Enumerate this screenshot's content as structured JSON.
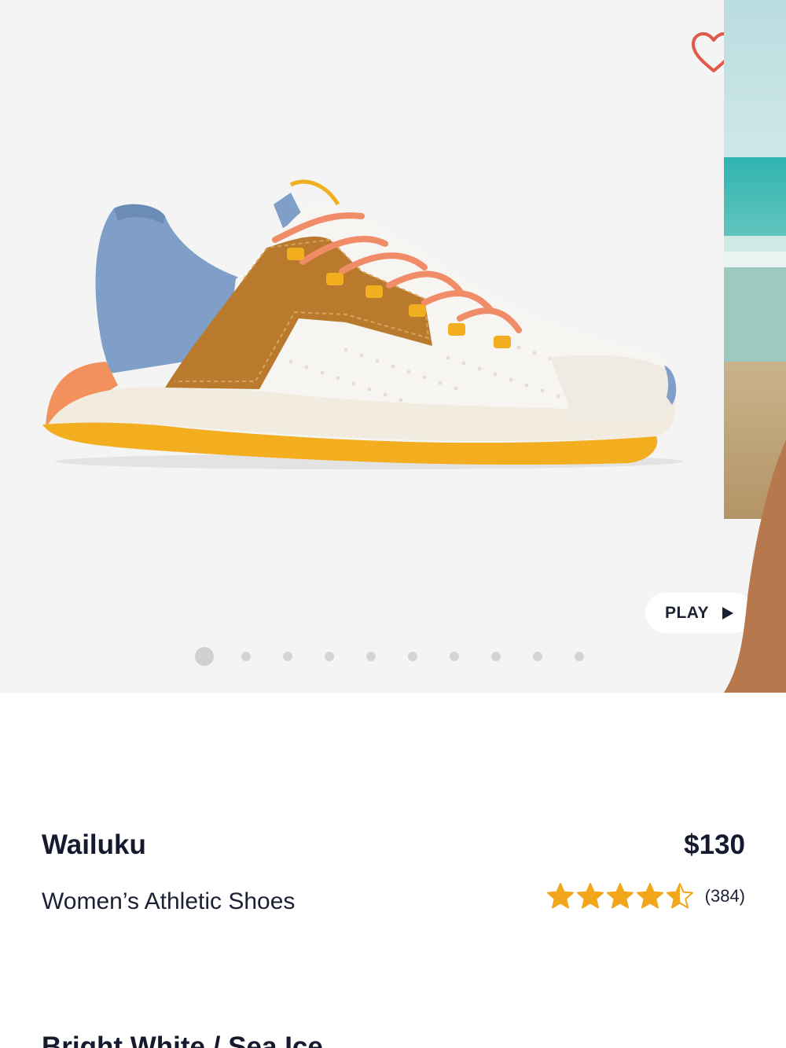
{
  "product": {
    "name": "Wailuku",
    "price": "$130",
    "category": "Women’s Athletic Shoes",
    "rating": 4.5,
    "rating_max": 5,
    "review_count": "(384)",
    "color_name": "Bright White / Sea Ice"
  },
  "gallery": {
    "play_label": "PLAY",
    "slide_count": 10,
    "active_slide": 1
  },
  "icons": {
    "wishlist": "heart-outline-icon",
    "play": "play-triangle-icon",
    "star": "star-icon"
  },
  "colors": {
    "heart": "#e05a4a",
    "star": "#f2a71b",
    "text": "#151a2e",
    "gallery_bg": "#f4f4f4"
  }
}
